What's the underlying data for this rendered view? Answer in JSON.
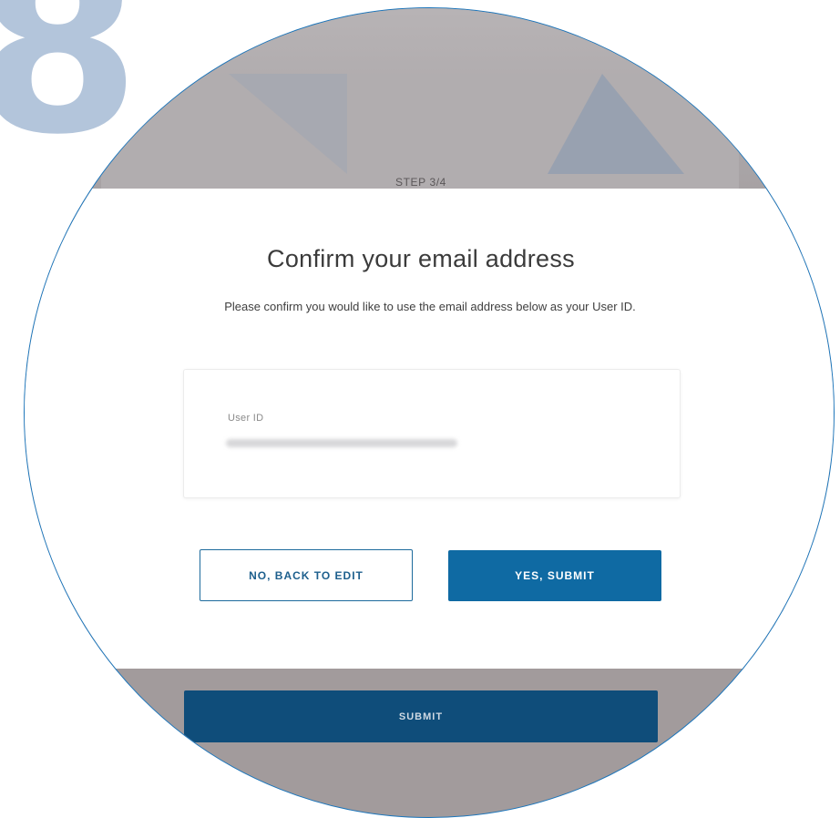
{
  "step_badge": "8",
  "background": {
    "step_label": "STEP 3/4",
    "submit_label": "SUBMIT"
  },
  "dialog": {
    "title": "Confirm your email address",
    "subtitle": "Please confirm you would like to use the email address below as your User ID.",
    "user_id_label": "User ID",
    "user_id_value": "",
    "back_button": "NO, BACK TO EDIT",
    "submit_button": "YES, SUBMIT"
  },
  "colors": {
    "primary": "#0f6aa3",
    "primary_dark": "#0f4d7a",
    "ring": "#1b75bb",
    "badge": "#b3c5db",
    "overlay": "#a29b9c"
  }
}
